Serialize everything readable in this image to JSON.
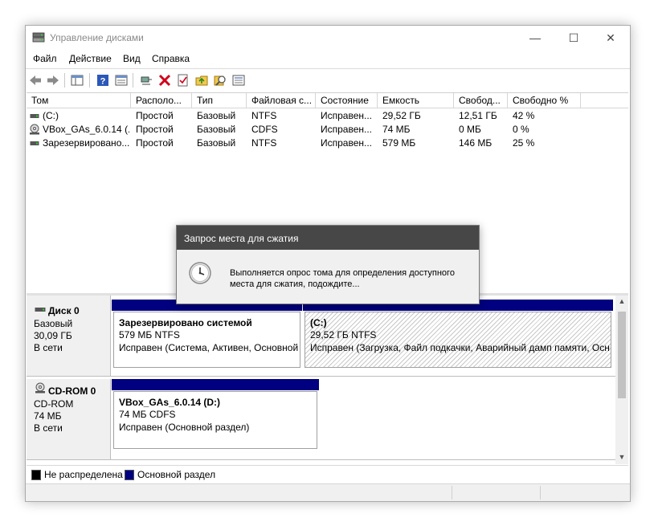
{
  "window": {
    "title": "Управление дисками",
    "controls": {
      "minimize": "—",
      "maximize": "☐",
      "close": "✕"
    }
  },
  "menu": [
    "Файл",
    "Действие",
    "Вид",
    "Справка"
  ],
  "toolbar": [
    "back-icon",
    "forward-icon",
    "console-tree-icon",
    "help-icon",
    "properties-icon",
    "connect-icon",
    "delete-icon",
    "checklist-icon",
    "open-folder-icon",
    "search-icon",
    "list-icon"
  ],
  "volumes": {
    "columns": [
      "Том",
      "Располо...",
      "Тип",
      "Файловая с...",
      "Состояние",
      "Емкость",
      "Свобод...",
      "Свободно %"
    ],
    "rows": [
      {
        "icon": "drive-icon",
        "cells": [
          "(C:)",
          "Простой",
          "Базовый",
          "NTFS",
          "Исправен...",
          "29,52 ГБ",
          "12,51 ГБ",
          "42 %"
        ]
      },
      {
        "icon": "cd-drive-icon",
        "cells": [
          "VBox_GAs_6.0.14 (...",
          "Простой",
          "Базовый",
          "CDFS",
          "Исправен...",
          "74 МБ",
          "0 МБ",
          "0 %"
        ]
      },
      {
        "icon": "drive-icon",
        "cells": [
          "Зарезервировано...",
          "Простой",
          "Базовый",
          "NTFS",
          "Исправен...",
          "579 МБ",
          "146 МБ",
          "25 %"
        ]
      }
    ]
  },
  "disks": [
    {
      "name": "Диск 0",
      "type": "Базовый",
      "size": "30,09 ГБ",
      "status": "В сети",
      "partitions": [
        {
          "name": "Зарезервировано системой",
          "size_fs": "579 МБ NTFS",
          "status": "Исправен (Система, Активен, Основной"
        },
        {
          "name": "(C:)",
          "size_fs": "29,52 ГБ NTFS",
          "status": "Исправен (Загрузка, Файл подкачки, Аварийный дамп памяти, Осн"
        }
      ]
    },
    {
      "name": "CD-ROM 0",
      "type": "CD-ROM",
      "size": "74 МБ",
      "status": "В сети",
      "partitions": [
        {
          "name": "VBox_GAs_6.0.14  (D:)",
          "size_fs": "74 МБ CDFS",
          "status": "Исправен (Основной раздел)"
        }
      ]
    }
  ],
  "legend": [
    {
      "label": "Не распределена",
      "color": "#000000"
    },
    {
      "label": "Основной раздел",
      "color": "#000080"
    }
  ],
  "dialog": {
    "title": "Запрос места для сжатия",
    "message": "Выполняется опрос тома для определения доступного места для сжатия, подождите...",
    "icon": "clock-icon"
  },
  "colors": {
    "partition_bar": "#000080",
    "dialog_title_bg": "#474747"
  }
}
